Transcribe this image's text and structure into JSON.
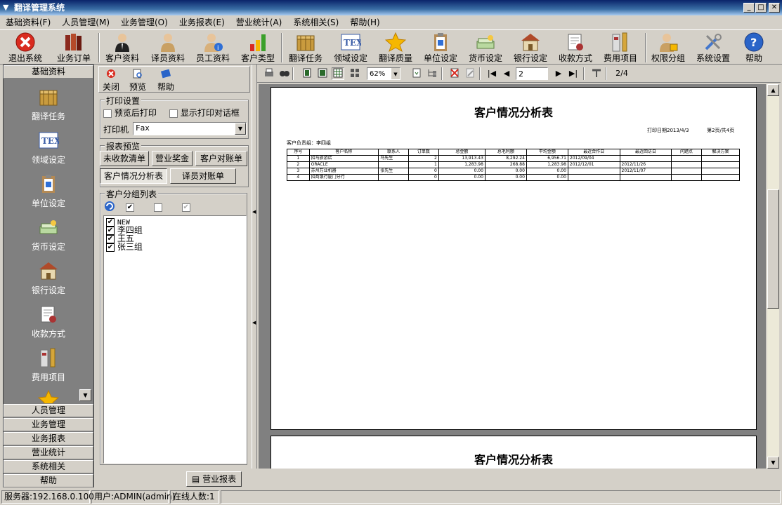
{
  "window": {
    "title": "翻译管理系统"
  },
  "menu": [
    "基础资料(F)",
    "人员管理(M)",
    "业务管理(O)",
    "业务报表(E)",
    "营业统计(A)",
    "系统相关(S)",
    "帮助(H)"
  ],
  "toolbar": {
    "items": [
      {
        "label": "退出系统",
        "icon": "exit-icon",
        "color": "#d92b1f"
      },
      {
        "label": "业务订单",
        "icon": "books-icon",
        "color": "#8b2a1e"
      },
      {
        "label": "客户资料",
        "icon": "client-icon",
        "color": "#222222"
      },
      {
        "label": "译员资料",
        "icon": "translator-icon",
        "color": "#c9a063"
      },
      {
        "label": "员工资料",
        "icon": "employee-icon",
        "color": "#2f6fd6"
      },
      {
        "label": "客户类型",
        "icon": "bar-chart-icon",
        "color": "#3aa02a"
      },
      {
        "label": "翻译任务",
        "icon": "task-box-icon",
        "color": "#c99b3e"
      },
      {
        "label": "领域设定",
        "icon": "tex-icon",
        "color": "#3b5ea7"
      },
      {
        "label": "翻译质量",
        "icon": "star-icon",
        "color": "#f5b700"
      },
      {
        "label": "单位设定",
        "icon": "clipboard-icon",
        "color": "#b48a55"
      },
      {
        "label": "货币设定",
        "icon": "money-icon",
        "color": "#7aa05a"
      },
      {
        "label": "银行设定",
        "icon": "bank-icon",
        "color": "#9a6d38"
      },
      {
        "label": "收款方式",
        "icon": "receipt-icon",
        "color": "#aa3333"
      },
      {
        "label": "费用项目",
        "icon": "ruler-icon",
        "color": "#d6a63a"
      },
      {
        "label": "权限分组",
        "icon": "lock-user-icon",
        "color": "#c9a063"
      },
      {
        "label": "系统设置",
        "icon": "tools-icon",
        "color": "#4477cc"
      },
      {
        "label": "帮助",
        "icon": "help-icon",
        "color": "#2a64c8"
      }
    ]
  },
  "leftpanel": {
    "header": "基础资料",
    "items": [
      {
        "label": "翻译任务",
        "icon": "task-box-icon"
      },
      {
        "label": "领域设定",
        "icon": "tex-icon"
      },
      {
        "label": "单位设定",
        "icon": "clipboard-icon"
      },
      {
        "label": "货币设定",
        "icon": "money-icon"
      },
      {
        "label": "银行设定",
        "icon": "bank-icon"
      },
      {
        "label": "收款方式",
        "icon": "receipt-icon"
      },
      {
        "label": "费用项目",
        "icon": "ruler-icon"
      }
    ],
    "sections": [
      "人员管理",
      "业务管理",
      "业务报表",
      "营业统计",
      "系统相关",
      "帮助"
    ]
  },
  "midpanel": {
    "actions": {
      "close": "关闭",
      "preview": "预览",
      "help": "帮助"
    },
    "print_group": {
      "title": "打印设置",
      "preview_after": "预览后打印",
      "show_dialog": "显示打印对话框",
      "printer_label": "打印机",
      "printer_value": "Fax"
    },
    "report_group": {
      "title": "报表预览",
      "buttons": [
        "未收款清单",
        "营业奖金",
        "客户对账单",
        "客户情况分析表",
        "译员对账单"
      ]
    },
    "client_group": {
      "title": "客户分组列表",
      "items": [
        "NEW",
        "李四组",
        "王五",
        "张三组"
      ]
    }
  },
  "viewer": {
    "zoom": "62%",
    "page_input": "2",
    "page_count": "2/4"
  },
  "report": {
    "title": "客户情况分析表",
    "print_date": "打印日期2013/4/3",
    "page_info": "第2页/共4页",
    "owner": "客户负责组：李四组",
    "columns": [
      "序号",
      "客户名称",
      "联系人",
      "订单数",
      "总金额",
      "总毛利额",
      "平均金额",
      "最近合作日",
      "最近回访日",
      "问题点",
      "解决方案"
    ],
    "rows": [
      [
        "1",
        "招马旅游店",
        "马先生",
        "2",
        "13,913.43",
        "8,292.24",
        "6,956.71",
        "2012/09/04",
        "",
        "",
        ""
      ],
      [
        "2",
        "ORACLE",
        "",
        "1",
        "1,283.98",
        "268.88",
        "1,283.98",
        "2012/12/01",
        "2012/11/26",
        "",
        ""
      ],
      [
        "3",
        "苏州万业机器",
        "张先生",
        "0",
        "0.00",
        "0.00",
        "0.00",
        "",
        "2012/11/07",
        "",
        ""
      ],
      [
        "4",
        "招商银行厦门分行",
        "",
        "0",
        "0.00",
        "0.00",
        "0.00",
        "",
        "",
        "",
        ""
      ]
    ]
  },
  "tasktab": "营业报表",
  "status": {
    "server": "服务器:192.168.0.100",
    "user": "用户:ADMIN(admin)",
    "online": "在线人数:1"
  }
}
